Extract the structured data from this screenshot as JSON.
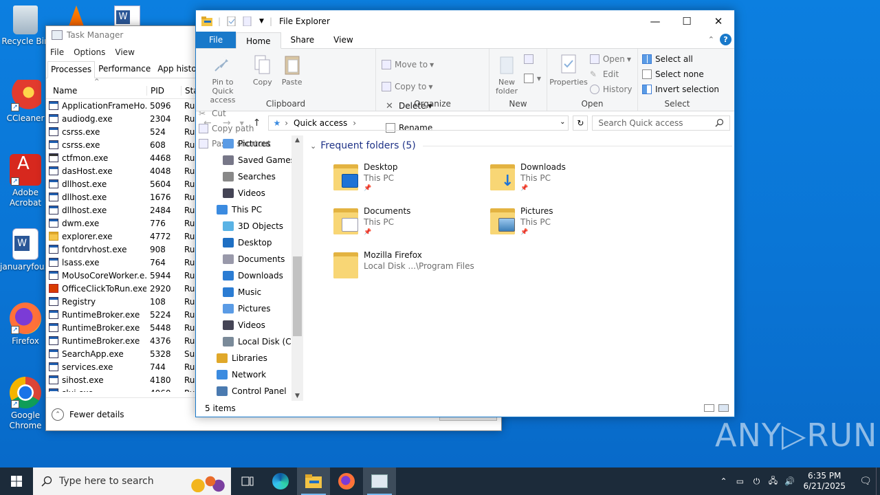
{
  "desktop": {
    "icons": [
      {
        "label": "Recycle Bin"
      },
      {
        "label": "CCleaner"
      },
      {
        "label": "Adobe Acrobat"
      },
      {
        "label": "januaryfou..."
      },
      {
        "label": "Firefox"
      },
      {
        "label": "Google Chrome"
      }
    ],
    "watermark": "ANY▷RUN"
  },
  "task_manager": {
    "title": "Task Manager",
    "menu": [
      "File",
      "Options",
      "View"
    ],
    "tabs": [
      "Processes",
      "Performance",
      "App history"
    ],
    "columns": {
      "name": "Name",
      "pid": "PID",
      "status": "Sta"
    },
    "rows": [
      {
        "name": "ApplicationFrameHo...",
        "pid": "5096",
        "status": "Ru"
      },
      {
        "name": "audiodg.exe",
        "pid": "2304",
        "status": "Ru"
      },
      {
        "name": "csrss.exe",
        "pid": "524",
        "status": "Ru"
      },
      {
        "name": "csrss.exe",
        "pid": "608",
        "status": "Ru"
      },
      {
        "name": "ctfmon.exe",
        "pid": "4468",
        "status": "Ru"
      },
      {
        "name": "dasHost.exe",
        "pid": "4048",
        "status": "Ru"
      },
      {
        "name": "dllhost.exe",
        "pid": "5604",
        "status": "Ru"
      },
      {
        "name": "dllhost.exe",
        "pid": "1676",
        "status": "Ru"
      },
      {
        "name": "dllhost.exe",
        "pid": "2484",
        "status": "Ru"
      },
      {
        "name": "dwm.exe",
        "pid": "776",
        "status": "Ru"
      },
      {
        "name": "explorer.exe",
        "pid": "4772",
        "status": "Ru"
      },
      {
        "name": "fontdrvhost.exe",
        "pid": "908",
        "status": "Ru"
      },
      {
        "name": "lsass.exe",
        "pid": "764",
        "status": "Ru"
      },
      {
        "name": "MoUsoCoreWorker.e...",
        "pid": "5944",
        "status": "Ru"
      },
      {
        "name": "OfficeClickToRun.exe",
        "pid": "2920",
        "status": "Ru"
      },
      {
        "name": "Registry",
        "pid": "108",
        "status": "Ru"
      },
      {
        "name": "RuntimeBroker.exe",
        "pid": "5224",
        "status": "Ru"
      },
      {
        "name": "RuntimeBroker.exe",
        "pid": "5448",
        "status": "Ru"
      },
      {
        "name": "RuntimeBroker.exe",
        "pid": "4376",
        "status": "Ru"
      },
      {
        "name": "SearchApp.exe",
        "pid": "5328",
        "status": "Sus"
      },
      {
        "name": "services.exe",
        "pid": "744",
        "status": "Ru"
      },
      {
        "name": "sihost.exe",
        "pid": "4180",
        "status": "Ru"
      },
      {
        "name": "slui.exe",
        "pid": "4060",
        "status": "Ru"
      }
    ],
    "fewer_details": "Fewer details"
  },
  "explorer": {
    "title": "File Explorer",
    "tabs": {
      "file": "File",
      "home": "Home",
      "share": "Share",
      "view": "View"
    },
    "ribbon": {
      "clipboard": {
        "label": "Clipboard",
        "pin": "Pin to Quick access",
        "copy": "Copy",
        "paste": "Paste",
        "cut": "Cut",
        "copy_path": "Copy path",
        "paste_shortcut": "Paste shortcut"
      },
      "organize": {
        "label": "Organize",
        "move_to": "Move to",
        "copy_to": "Copy to",
        "delete": "Delete",
        "rename": "Rename"
      },
      "new": {
        "label": "New",
        "new_folder": "New folder"
      },
      "open": {
        "label": "Open",
        "properties": "Properties",
        "open": "Open",
        "edit": "Edit",
        "history": "History"
      },
      "select": {
        "label": "Select",
        "select_all": "Select all",
        "select_none": "Select none",
        "invert": "Invert selection"
      }
    },
    "address": {
      "path": "Quick access",
      "search_placeholder": "Search Quick access"
    },
    "nav": [
      {
        "label": "Pictures",
        "indent": 1
      },
      {
        "label": "Saved Games",
        "indent": 1
      },
      {
        "label": "Searches",
        "indent": 1
      },
      {
        "label": "Videos",
        "indent": 1
      },
      {
        "label": "This PC",
        "indent": 0
      },
      {
        "label": "3D Objects",
        "indent": 1
      },
      {
        "label": "Desktop",
        "indent": 1
      },
      {
        "label": "Documents",
        "indent": 1
      },
      {
        "label": "Downloads",
        "indent": 1
      },
      {
        "label": "Music",
        "indent": 1
      },
      {
        "label": "Pictures",
        "indent": 1
      },
      {
        "label": "Videos",
        "indent": 1
      },
      {
        "label": "Local Disk (C:)",
        "indent": 1
      },
      {
        "label": "Libraries",
        "indent": 0
      },
      {
        "label": "Network",
        "indent": 0
      },
      {
        "label": "Control Panel",
        "indent": 0
      }
    ],
    "section": "Frequent folders (5)",
    "folders": [
      {
        "name": "Desktop",
        "location": "This PC",
        "pinned": true,
        "overlay": "desktop"
      },
      {
        "name": "Downloads",
        "location": "This PC",
        "pinned": true,
        "overlay": "download"
      },
      {
        "name": "Documents",
        "location": "This PC",
        "pinned": true,
        "overlay": "document"
      },
      {
        "name": "Pictures",
        "location": "This PC",
        "pinned": true,
        "overlay": "picture"
      },
      {
        "name": "Mozilla Firefox",
        "location": "Local Disk ...\\Program Files",
        "pinned": false,
        "overlay": "none"
      }
    ],
    "status": "5 items"
  },
  "taskbar": {
    "search_placeholder": "Type here to search",
    "time": "6:35 PM",
    "date": "6/21/2025"
  },
  "colors": {
    "accent": "#1979ca",
    "desktop": "#0a78d7",
    "taskbar": "#1c2b3a"
  }
}
